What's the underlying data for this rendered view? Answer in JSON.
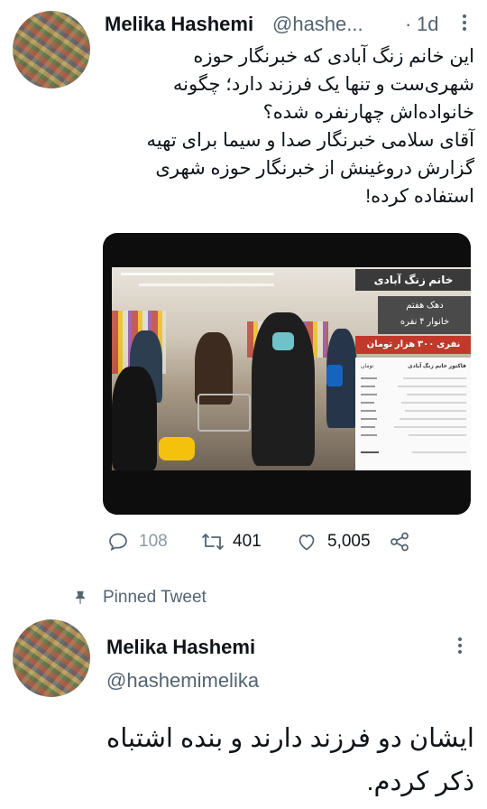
{
  "tweet1": {
    "author_name": "Melika Hashemi",
    "author_handle": "@hashe...",
    "separator": "·",
    "time": "1d",
    "text_lines": [
      "این خانم زنگ آبادی که خبرنگار حوزه",
      "شهری‌ست و تنها یک فرزند دارد؛ چگونه",
      "خانواده‌اش چهارنفره شده؟",
      "آقای سلامی خبرنگار صدا و سیما برای تهیه",
      "گزارش دروغینش از خبرنگار حوزه شهری",
      "استفاده کرده!"
    ],
    "media": {
      "title_card": "خانم زنگ آبادی",
      "subtitle_line1": "دهک هفتم",
      "subtitle_line2": "خانوار ۴ نفره",
      "red_banner": "نفری ۳۰۰ هزار تومان",
      "receipt_title": "فاکتور خانم زنگ آبادی",
      "receipt_unit": "تومان"
    },
    "actions": {
      "replies": "108",
      "retweets": "401",
      "likes": "5,005"
    }
  },
  "pinned_label": "Pinned Tweet",
  "tweet2": {
    "author_name": "Melika Hashemi",
    "author_handle": "@hashemimelika",
    "text_lines": [
      "ایشان دو فرزند دارند و بنده اشتباه",
      "ذکر کردم."
    ]
  },
  "colors": {
    "text_primary": "#0f1419",
    "text_secondary": "#536471",
    "red_banner": "#c0392b"
  },
  "icons": [
    "reply-icon",
    "retweet-icon",
    "like-icon",
    "share-icon",
    "pin-icon",
    "more-icon"
  ]
}
